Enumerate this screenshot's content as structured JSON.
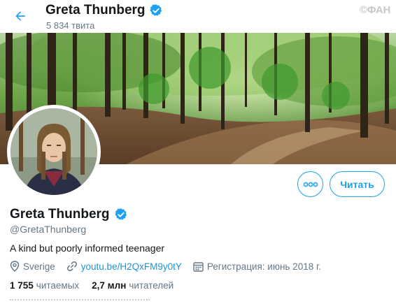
{
  "header": {
    "name": "Greta Thunberg",
    "tweet_count": "5 834 твита",
    "watermark": "©ФАН"
  },
  "actions": {
    "more_icon": "ellipsis-icon",
    "follow_label": "Читать"
  },
  "profile": {
    "name": "Greta Thunberg",
    "handle": "@GretaThunberg",
    "bio": "A kind but poorly informed teenager",
    "location": "Sverige",
    "link": "youtu.be/H2QxFM9y0tY",
    "joined": "Регистрация: июнь 2018 г.",
    "following_count": "1 755",
    "following_label": "читаемых",
    "followers_count": "2,7 млн",
    "followers_label": "читателей"
  },
  "colors": {
    "accent": "#1da1f2",
    "verified": "#1da1f2",
    "link": "#1b95e0",
    "muted": "#657786"
  }
}
